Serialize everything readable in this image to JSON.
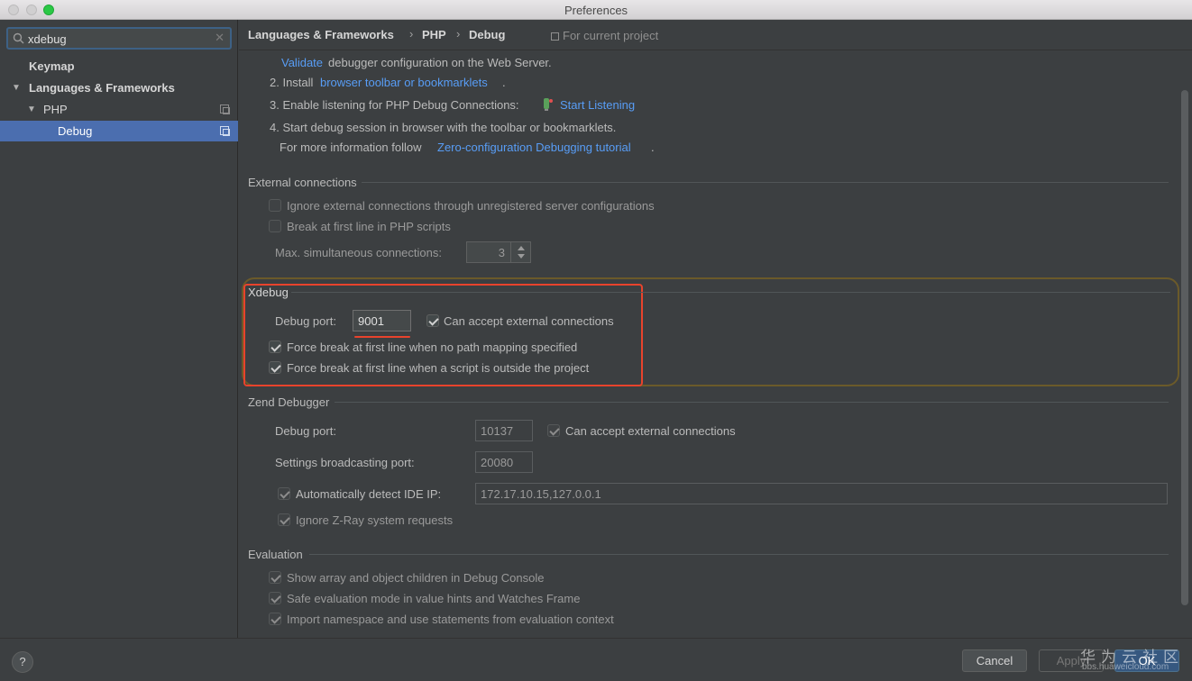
{
  "window": {
    "title": "Preferences"
  },
  "sidebar": {
    "search": {
      "value": "xdebug",
      "placeholder": ""
    },
    "items": [
      {
        "label": "Keymap"
      },
      {
        "label": "Languages & Frameworks"
      },
      {
        "label": "PHP"
      },
      {
        "label": "Debug"
      }
    ]
  },
  "breadcrumb": {
    "items": [
      "Languages & Frameworks",
      "PHP",
      "Debug"
    ],
    "separator": "›",
    "for_project": "For current project"
  },
  "steps": {
    "step1_link": "Validate",
    "step1_text": "debugger configuration on the Web Server.",
    "step2_prefix": "2. Install",
    "step2_link": "browser toolbar or bookmarklets",
    "step2_suffix": ".",
    "step3_text": "3. Enable listening for PHP Debug Connections:",
    "step3_link": "Start Listening",
    "step4_text": "4. Start debug session in browser with the toolbar or bookmarklets.",
    "more_prefix": "For more information follow",
    "more_link": "Zero-configuration Debugging tutorial",
    "more_suffix": "."
  },
  "external": {
    "title": "External connections",
    "ignore_label": "Ignore external connections through unregistered server configurations",
    "break_label": "Break at first line in PHP scripts",
    "max_label": "Max. simultaneous connections:",
    "max_value": "3"
  },
  "xdebug": {
    "title": "Xdebug",
    "port_label": "Debug port:",
    "port_value": "9001",
    "accept_label": "Can accept external connections",
    "force_no_mapping_label": "Force break at first line when no path mapping specified",
    "force_outside_label": "Force break at first line when a script is outside the project"
  },
  "zend": {
    "title": "Zend Debugger",
    "port_label": "Debug port:",
    "port_value": "10137",
    "accept_label": "Can accept external connections",
    "broadcast_label": "Settings broadcasting port:",
    "broadcast_value": "20080",
    "detect_label": "Automatically detect IDE IP:",
    "detect_value": "172.17.10.15,127.0.0.1",
    "ignore_zray_label": "Ignore Z-Ray system requests"
  },
  "evaluation": {
    "title": "Evaluation",
    "show_array_label": "Show array and object children in Debug Console",
    "safe_eval_label": "Safe evaluation mode in value hints and Watches Frame",
    "import_ns_label": "Import namespace and use statements from evaluation context"
  },
  "buttons": {
    "help": "?",
    "cancel": "Cancel",
    "apply": "Apply",
    "ok": "OK"
  },
  "watermark": {
    "title": "华为云社区",
    "url": "bbs.huaweicloud.com"
  },
  "colors": {
    "accent": "#4b6eaf",
    "link": "#589df6",
    "highlight_red": "#e8432c"
  }
}
